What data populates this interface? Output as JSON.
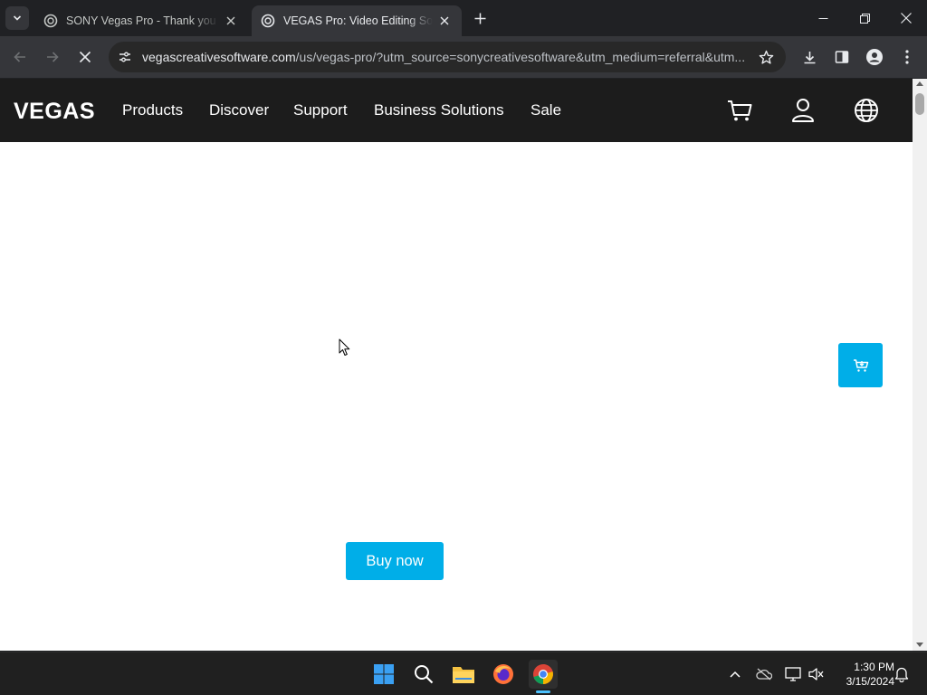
{
  "browser": {
    "tabs": [
      {
        "title": "SONY Vegas Pro - Thank you fo",
        "active": false,
        "favicon": "vegas-favicon"
      },
      {
        "title": "VEGAS Pro: Video Editing Softw",
        "active": true,
        "favicon": "vegas-favicon"
      }
    ],
    "url": {
      "host": "vegascreativesoftware.com",
      "path": "/us/vegas-pro/?utm_source=sonycreativesoftware&utm_medium=referral&utm..."
    }
  },
  "site": {
    "logo": "VEGAS",
    "nav": [
      "Products",
      "Discover",
      "Support",
      "Business Solutions",
      "Sale"
    ],
    "icons": [
      "cart-icon",
      "account-icon",
      "globe-icon"
    ],
    "buy_now_label": "Buy now",
    "accent_color": "#00aee8",
    "nav_bg_color": "#1c1c1c"
  },
  "taskbar": {
    "apps": [
      "windows-start-icon",
      "search-icon",
      "file-explorer-icon",
      "firefox-icon",
      "chrome-icon"
    ],
    "time": "1:30 PM",
    "date": "3/15/2024"
  }
}
